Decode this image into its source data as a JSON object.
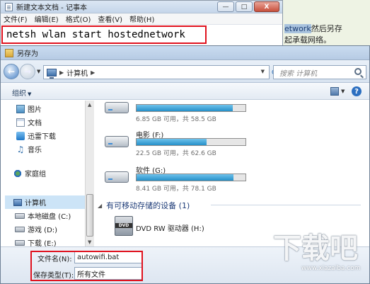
{
  "background": {
    "text_line1_highlight": "etwork",
    "text_line1_rest": "然后另存",
    "text_line2": "起承载网络。"
  },
  "notepad": {
    "title": "新建文本文档 - 记事本",
    "menus": [
      "文件(F)",
      "编辑(E)",
      "格式(O)",
      "查看(V)",
      "帮助(H)"
    ],
    "content": "netsh wlan start hostednetwork",
    "window_buttons": [
      "—",
      "□",
      "X"
    ]
  },
  "dialog": {
    "title": "另存为",
    "address_path": "计算机",
    "search_placeholder": "搜索 计算机",
    "organize_label": "组织",
    "help_label": "?",
    "nav_items": [
      {
        "label": "图片",
        "icon": "pictures-icon"
      },
      {
        "label": "文档",
        "icon": "documents-icon"
      },
      {
        "label": "迅雷下载",
        "icon": "download-folder-icon"
      },
      {
        "label": "音乐",
        "icon": "music-icon"
      },
      {
        "label": "家庭组",
        "icon": "homegroup-icon"
      },
      {
        "label": "计算机",
        "icon": "computer-icon"
      },
      {
        "label": "本地磁盘 (C:)",
        "icon": "drive-icon"
      },
      {
        "label": "游戏 (D:)",
        "icon": "drive-icon"
      },
      {
        "label": "下载 (E:)",
        "icon": "drive-icon"
      }
    ],
    "drives": [
      {
        "name": "",
        "sub": "6.85 GB 可用，共 58.5 GB",
        "used_fraction": 0.88
      },
      {
        "name": "电影 (F:)",
        "sub": "22.5 GB 可用，共 62.6 GB",
        "used_fraction": 0.64
      },
      {
        "name": "软件 (G:)",
        "sub": "8.41 GB 可用，共 78.1 GB",
        "used_fraction": 0.89
      }
    ],
    "removable_header": "有可移动存储的设备 (1)",
    "dvd": {
      "icon_text": "DVD",
      "name": "DVD RW 驱动器 (H:)"
    },
    "filename_label": "文件名(N):",
    "filename_value": "autowifi.bat",
    "filetype_label": "保存类型(T):",
    "filetype_value": "所有文件"
  },
  "watermark": {
    "glyphs": [
      "下",
      "载",
      "吧"
    ],
    "url": "www.xiazaiba.com"
  },
  "colors": {
    "highlight_box": "#e0121e",
    "drive_bar": "#2590c8"
  }
}
